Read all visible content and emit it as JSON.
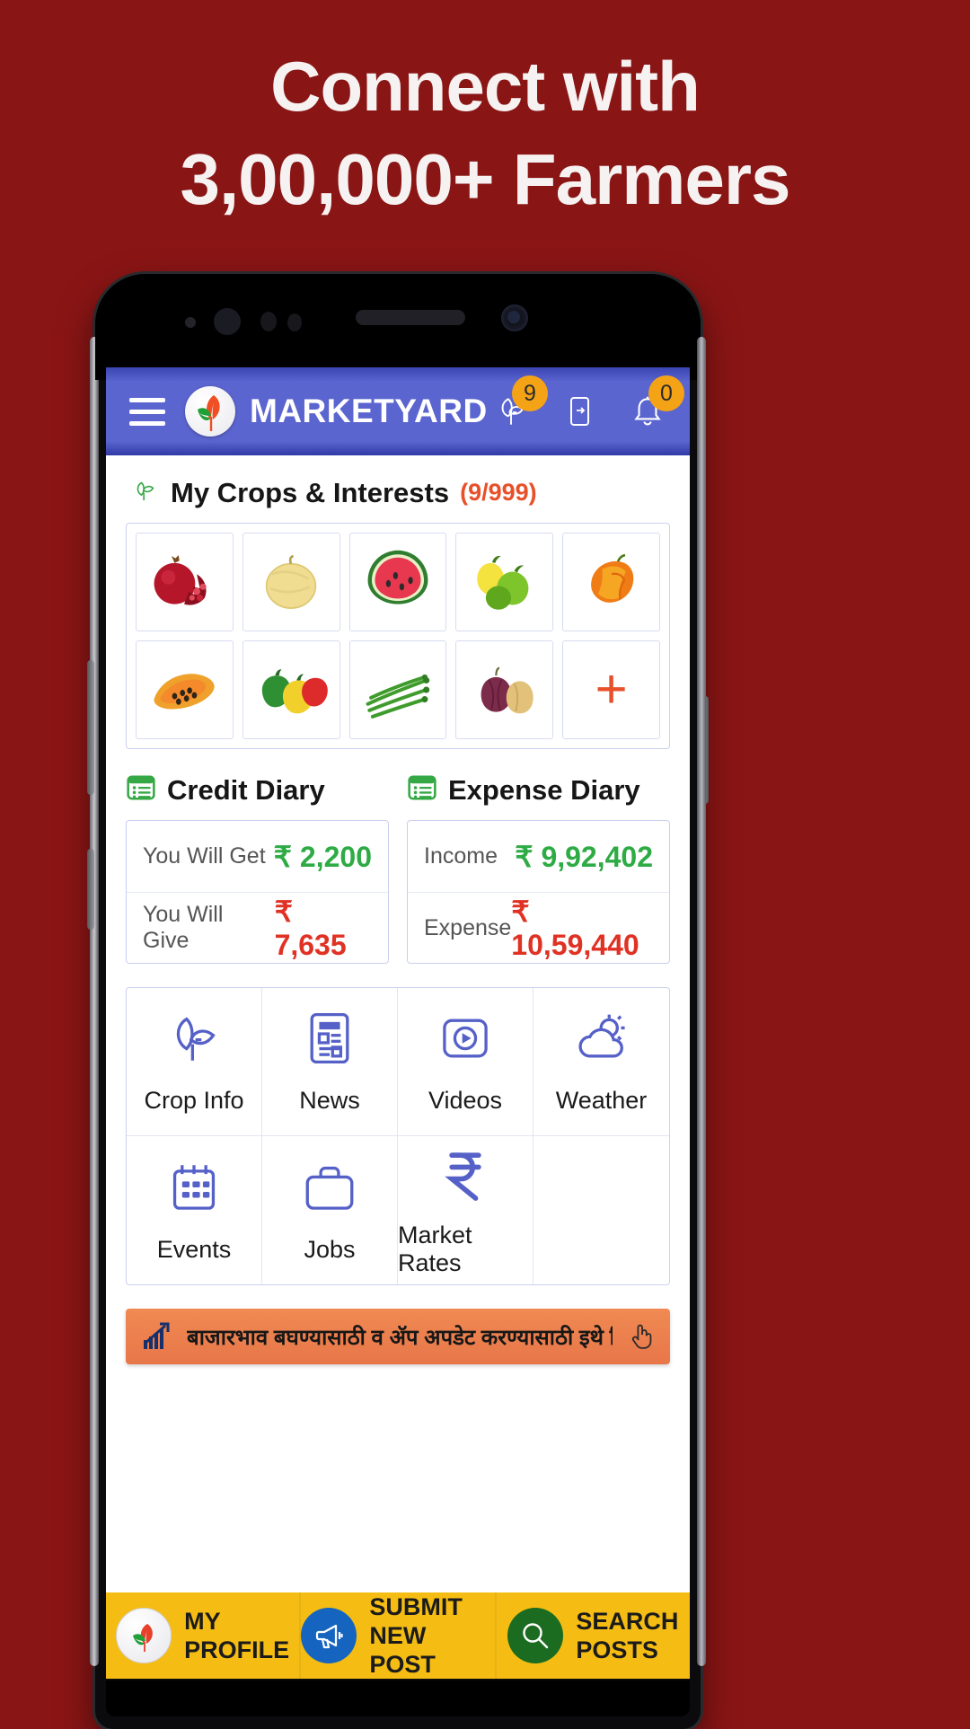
{
  "promo": {
    "line1": "Connect with",
    "line2": "3,00,000+ Farmers",
    "background_color": "#8a1515",
    "text_color": "#f7f2f2"
  },
  "appbar": {
    "brand": "MARKETYARD",
    "background_color": "#5b65cf",
    "menu_icon": "hamburger-icon",
    "crops_badge": "9",
    "notifications_badge": "0",
    "share_icon": "mobile-share-icon",
    "crops_icon": "sprout-icon",
    "bell_icon": "bell-icon"
  },
  "crops_section": {
    "icon": "sprout-icon",
    "title": "My Crops & Interests",
    "count": "(9/999)",
    "count_color": "#e8502a",
    "items": [
      {
        "name": "pomegranate",
        "label": "Pomegranate"
      },
      {
        "name": "muskmelon",
        "label": "Muskmelon"
      },
      {
        "name": "watermelon",
        "label": "Watermelon"
      },
      {
        "name": "lemon",
        "label": "Lemon"
      },
      {
        "name": "mango",
        "label": "Mango"
      },
      {
        "name": "papaya",
        "label": "Papaya"
      },
      {
        "name": "capsicum",
        "label": "Capsicum"
      },
      {
        "name": "asparagus",
        "label": "Asparagus"
      },
      {
        "name": "onion",
        "label": "Onion"
      },
      {
        "name": "add",
        "label": "+"
      }
    ],
    "add_symbol": "+"
  },
  "credit_diary": {
    "title": "Credit Diary",
    "icon": "list-card-icon",
    "rows": [
      {
        "label": "You Will Get",
        "value": "₹ 2,200",
        "color": "#2eab45"
      },
      {
        "label": "You Will Give",
        "value": "₹ 7,635",
        "color": "#e03224"
      }
    ]
  },
  "expense_diary": {
    "title": "Expense Diary",
    "icon": "list-card-icon",
    "rows": [
      {
        "label": "Income",
        "value": "₹ 9,92,402",
        "color": "#2eab45"
      },
      {
        "label": "Expense",
        "value": "₹ 10,59,440",
        "color": "#e03224"
      }
    ]
  },
  "menu_grid": {
    "accent_color": "#5661c8",
    "items": [
      {
        "label": "Crop Info",
        "icon": "sprout-icon"
      },
      {
        "label": "News",
        "icon": "newspaper-icon"
      },
      {
        "label": "Videos",
        "icon": "video-play-icon"
      },
      {
        "label": "Weather",
        "icon": "sun-cloud-icon"
      },
      {
        "label": "Events",
        "icon": "calendar-icon"
      },
      {
        "label": "Jobs",
        "icon": "briefcase-icon"
      },
      {
        "label": "Market Rates",
        "icon": "rupee-icon"
      },
      {
        "label": "",
        "icon": ""
      }
    ]
  },
  "banner": {
    "icon": "growth-chart-icon",
    "text": "बाजारभाव बघण्यासाठी व ॲप अपडेट करण्यासाठी इथे क्लिक करा",
    "hand_icon": "tap-hand-icon",
    "background_color": "#e8764a"
  },
  "bottom_nav": {
    "background_color": "#f5bd13",
    "items": [
      {
        "line1": "MY",
        "line2": "PROFILE",
        "icon": "profile-leaf-icon",
        "icon_bg": "#ffffff"
      },
      {
        "line1": "SUBMIT",
        "line2": "NEW POST",
        "icon": "megaphone-icon",
        "icon_bg": "#1565c0"
      },
      {
        "line1": "SEARCH",
        "line2": "POSTS",
        "icon": "magnifier-icon",
        "icon_bg": "#1b6b21"
      }
    ]
  }
}
